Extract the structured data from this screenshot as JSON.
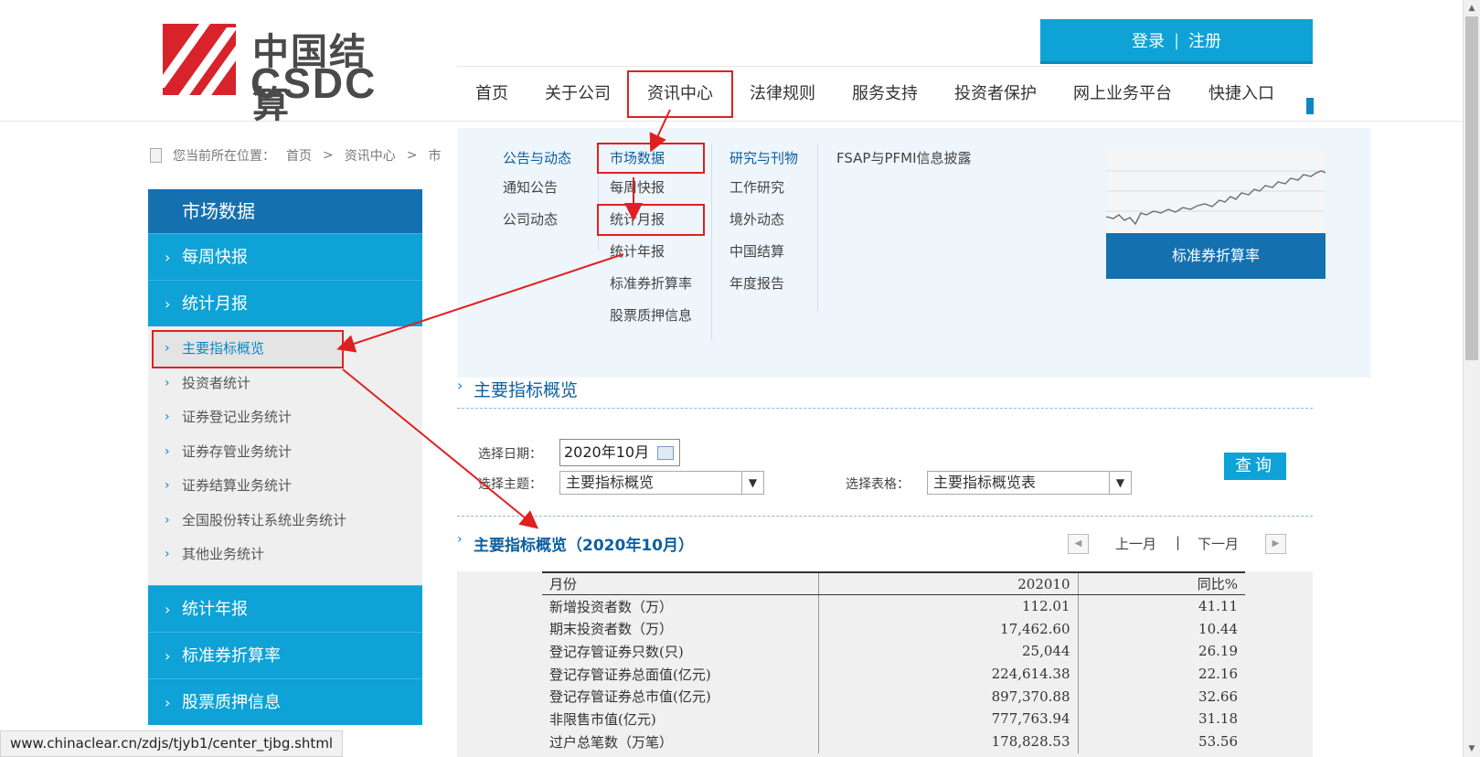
{
  "header": {
    "logo_cn": "中国结算",
    "logo_en": "CSDC",
    "login": "登录",
    "login_sep": "|",
    "register": "注册"
  },
  "nav": [
    "首页",
    "关于公司",
    "资讯中心",
    "法律规则",
    "服务支持",
    "投资者保护",
    "网上业务平台",
    "快捷入口"
  ],
  "breadcrumb": {
    "prefix": "您当前所在位置：",
    "items": [
      "首页",
      "资讯中心",
      "市"
    ],
    "sep": ">"
  },
  "sidebar": {
    "title": "市场数据",
    "top_items": [
      "每周快报",
      "统计月报"
    ],
    "sub_items": [
      "主要指标概览",
      "投资者统计",
      "证券登记业务统计",
      "证券存管业务统计",
      "证券结算业务统计",
      "全国股份转让系统业务统计",
      "其他业务统计"
    ],
    "bottom_items": [
      "统计年报",
      "标准券折算率",
      "股票质押信息"
    ]
  },
  "dropdown": {
    "col1": {
      "head": "公告与动态",
      "links": [
        "通知公告",
        "公司动态"
      ]
    },
    "col2": {
      "head": "市场数据",
      "links": [
        "每周快报",
        "统计月报",
        "统计年报",
        "标准券折算率",
        "股票质押信息"
      ]
    },
    "col3": {
      "head": "研究与刊物",
      "links": [
        "工作研究",
        "境外动态",
        "中国结算",
        "年度报告"
      ]
    },
    "col4": {
      "head": "FSAP与PFMI信息披露"
    },
    "feature_button": "标准券折算率"
  },
  "content": {
    "section_title": "主要指标概览",
    "date_label": "选择日期：",
    "date_value": "2020年10月",
    "topic_label": "选择主题：",
    "topic_value": "主要指标概览",
    "table_label": "选择表格：",
    "table_value": "主要指标概览表",
    "query": "查询",
    "result_title": "主要指标概览（2020年10月）",
    "prev_month": "上一月",
    "pager_sep": "|",
    "next_month": "下一月"
  },
  "table": {
    "headers": [
      "月份",
      "202010",
      "同比%"
    ],
    "rows": [
      [
        "新增投资者数（万）",
        "112.01",
        "41.11"
      ],
      [
        "期末投资者数（万）",
        "17,462.60",
        "10.44"
      ],
      [
        "登记存管证券只数(只)",
        "25,044",
        "26.19"
      ],
      [
        "登记存管证券总面值(亿元)",
        "224,614.38",
        "22.16"
      ],
      [
        "登记存管证券总市值(亿元)",
        "897,370.88",
        "32.66"
      ],
      [
        "非限售市值(亿元)",
        "777,763.94",
        "31.18"
      ],
      [
        "过户总笔数（万笔）",
        "178,828.53",
        "53.56"
      ]
    ]
  },
  "status_url": "www.chinaclear.cn/zdjs/tjyb1/center_tjbg.shtml",
  "colors": {
    "brand_red": "#d8232a",
    "primary_blue": "#0ea2d6",
    "dark_blue": "#1570b0",
    "annotation_red": "#e02020"
  }
}
